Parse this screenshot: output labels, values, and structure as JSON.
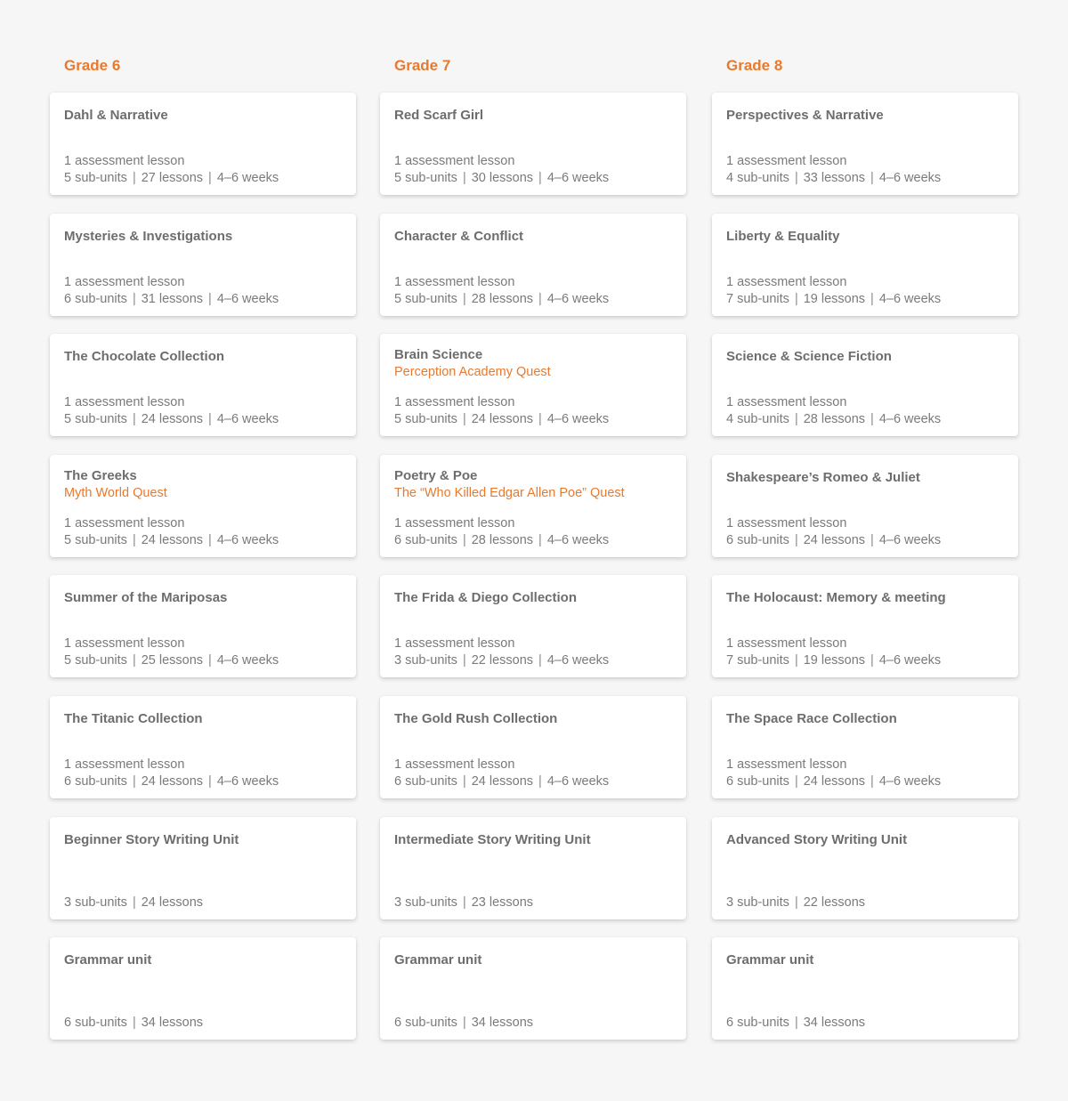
{
  "accent_color": "#e8792d",
  "columns": [
    {
      "grade": "Grade 6",
      "cards": [
        {
          "title": "Dahl & Narrative",
          "subtitle": "",
          "assessment": "1 assessment lesson",
          "subunits": "5 sub-units",
          "lessons": "27 lessons",
          "duration": "4–6 weeks"
        },
        {
          "title": "Mysteries & Investigations",
          "subtitle": "",
          "assessment": "1 assessment lesson",
          "subunits": "6 sub-units",
          "lessons": "31 lessons",
          "duration": "4–6 weeks"
        },
        {
          "title": "The Chocolate Collection",
          "subtitle": "",
          "assessment": "1 assessment lesson",
          "subunits": "5 sub-units",
          "lessons": "24 lessons",
          "duration": "4–6 weeks"
        },
        {
          "title": "The Greeks",
          "subtitle": "Myth World Quest",
          "assessment": "1 assessment lesson",
          "subunits": "5 sub-units",
          "lessons": "24 lessons",
          "duration": "4–6 weeks"
        },
        {
          "title": "Summer of the Mariposas",
          "subtitle": "",
          "assessment": "1 assessment lesson",
          "subunits": "5 sub-units",
          "lessons": "25 lessons",
          "duration": "4–6 weeks"
        },
        {
          "title": "The Titanic Collection",
          "subtitle": "",
          "assessment": "1 assessment lesson",
          "subunits": "6 sub-units",
          "lessons": "24 lessons",
          "duration": "4–6 weeks"
        },
        {
          "title": "Beginner Story Writing Unit",
          "subtitle": "",
          "assessment": "",
          "subunits": "3 sub-units",
          "lessons": "24 lessons",
          "duration": ""
        },
        {
          "title": "Grammar unit",
          "subtitle": "",
          "assessment": "",
          "subunits": "6 sub-units",
          "lessons": "34 lessons",
          "duration": ""
        }
      ]
    },
    {
      "grade": "Grade 7",
      "cards": [
        {
          "title": "Red Scarf Girl",
          "subtitle": "",
          "assessment": "1 assessment lesson",
          "subunits": "5 sub-units",
          "lessons": "30 lessons",
          "duration": "4–6 weeks"
        },
        {
          "title": "Character & Conflict",
          "subtitle": "",
          "assessment": "1 assessment lesson",
          "subunits": "5 sub-units",
          "lessons": "28 lessons",
          "duration": "4–6 weeks"
        },
        {
          "title": "Brain Science",
          "subtitle": "Perception Academy Quest",
          "assessment": "1 assessment lesson",
          "subunits": "5 sub-units",
          "lessons": "24 lessons",
          "duration": "4–6 weeks"
        },
        {
          "title": "Poetry & Poe",
          "subtitle": "The “Who Killed Edgar Allen Poe” Quest",
          "assessment": "1 assessment lesson",
          "subunits": "6 sub-units",
          "lessons": "28 lessons",
          "duration": "4–6 weeks"
        },
        {
          "title": "The Frida & Diego Collection",
          "subtitle": "",
          "assessment": "1 assessment lesson",
          "subunits": "3 sub-units",
          "lessons": "22 lessons",
          "duration": "4–6 weeks"
        },
        {
          "title": "The Gold Rush Collection",
          "subtitle": "",
          "assessment": "1 assessment lesson",
          "subunits": "6 sub-units",
          "lessons": "24 lessons",
          "duration": "4–6 weeks"
        },
        {
          "title": "Intermediate Story Writing Unit",
          "subtitle": "",
          "assessment": "",
          "subunits": "3 sub-units",
          "lessons": "23 lessons",
          "duration": ""
        },
        {
          "title": "Grammar unit",
          "subtitle": "",
          "assessment": "",
          "subunits": "6 sub-units",
          "lessons": "34 lessons",
          "duration": ""
        }
      ]
    },
    {
      "grade": "Grade 8",
      "cards": [
        {
          "title": "Perspectives & Narrative",
          "subtitle": "",
          "assessment": "1 assessment lesson",
          "subunits": "4 sub-units",
          "lessons": "33 lessons",
          "duration": "4–6 weeks"
        },
        {
          "title": "Liberty & Equality",
          "subtitle": "",
          "assessment": "1 assessment lesson",
          "subunits": "7 sub-units",
          "lessons": "19 lessons",
          "duration": "4–6 weeks"
        },
        {
          "title": "Science & Science Fiction",
          "subtitle": "",
          "assessment": "1 assessment lesson",
          "subunits": "4 sub-units",
          "lessons": "28 lessons",
          "duration": "4–6 weeks"
        },
        {
          "title": "Shakespeare’s Romeo & Juliet",
          "subtitle": "",
          "assessment": "1 assessment lesson",
          "subunits": "6 sub-units",
          "lessons": "24 lessons",
          "duration": "4–6 weeks"
        },
        {
          "title": "The Holocaust: Memory & meeting",
          "subtitle": "",
          "assessment": "1 assessment lesson",
          "subunits": "7 sub-units",
          "lessons": "19 lessons",
          "duration": "4–6 weeks"
        },
        {
          "title": "The Space Race Collection",
          "subtitle": "",
          "assessment": "1 assessment lesson",
          "subunits": "6 sub-units",
          "lessons": "24 lessons",
          "duration": "4–6 weeks"
        },
        {
          "title": "Advanced Story Writing Unit",
          "subtitle": "",
          "assessment": "",
          "subunits": "3 sub-units",
          "lessons": "22 lessons",
          "duration": ""
        },
        {
          "title": "Grammar unit",
          "subtitle": "",
          "assessment": "",
          "subunits": "6 sub-units",
          "lessons": "34 lessons",
          "duration": ""
        }
      ]
    }
  ]
}
